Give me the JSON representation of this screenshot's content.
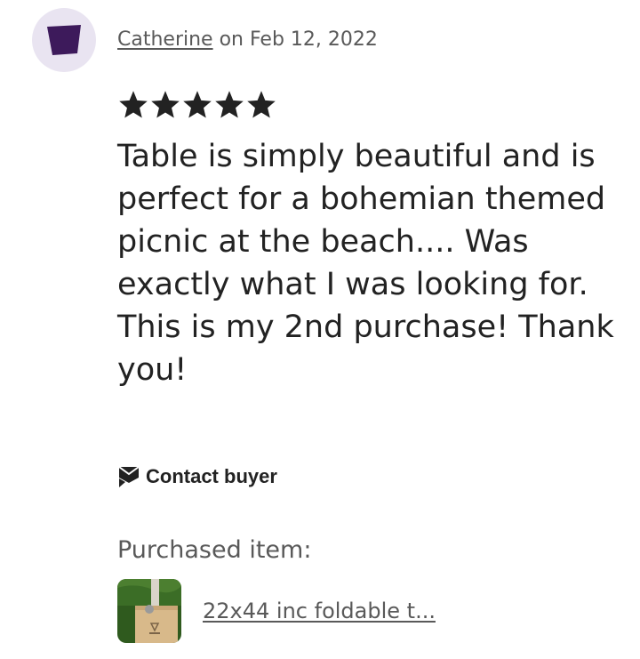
{
  "review": {
    "author": "Catherine",
    "date_text": " on Feb 12, 2022",
    "rating": 5,
    "rating_max": 5,
    "text": "Table is simply beautiful and is perfect for a bohemian themed picnic at the beach.... Was exactly what I was looking for. This is my 2nd purchase! Thank you!"
  },
  "actions": {
    "contact_label": "Contact buyer",
    "contact_icon": "message-icon"
  },
  "purchased": {
    "label": "Purchased item:",
    "item_title": "22x44 inc foldable t..."
  },
  "colors": {
    "avatar_bg": "#e9e4f1",
    "avatar_icon": "#3d1a5b",
    "text": "#222222",
    "muted": "#595959"
  }
}
